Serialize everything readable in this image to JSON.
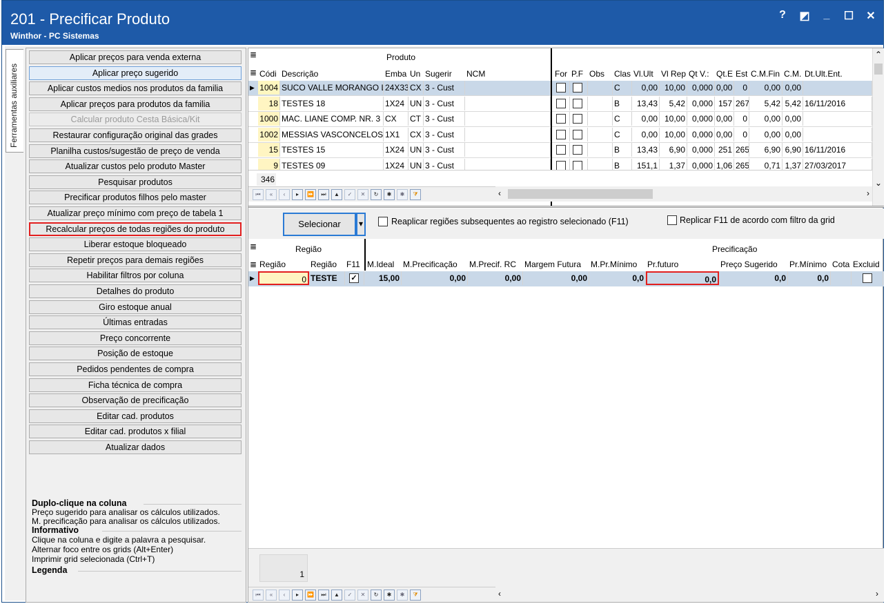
{
  "window": {
    "title": "201 - Precificar Produto",
    "subtitle": "Winthor - PC Sistemas",
    "help": "?",
    "restore": "◩",
    "minimize": "_",
    "maximize": "☐",
    "close": "✕"
  },
  "side_tab": "Ferramentas auxiliares",
  "actions": [
    {
      "label": "Aplicar preços para venda externa",
      "state": "normal"
    },
    {
      "label": "Aplicar preço sugerido",
      "state": "selected"
    },
    {
      "label": "Aplicar custos medios nos produtos da familia",
      "state": "normal"
    },
    {
      "label": "Aplicar preços para produtos da familia",
      "state": "normal"
    },
    {
      "label": "Calcular produto Cesta Básica/Kit",
      "state": "disabled"
    },
    {
      "label": "Restaurar configuração original das grades",
      "state": "normal"
    },
    {
      "label": "Planilha custos/sugestão de preço de venda",
      "state": "normal"
    },
    {
      "label": "Atualizar custos pelo produto Master",
      "state": "normal"
    },
    {
      "label": "Pesquisar produtos",
      "state": "normal"
    },
    {
      "label": "Precificar produtos filhos pelo master",
      "state": "normal"
    },
    {
      "label": "Atualizar preço mínimo com preço de tabela 1",
      "state": "normal"
    },
    {
      "label": "Recalcular preços de todas regiões do produto",
      "state": "highlighted"
    },
    {
      "label": "Liberar estoque bloqueado",
      "state": "normal"
    },
    {
      "label": "Repetir preços para demais regiões",
      "state": "normal"
    },
    {
      "label": "Habilitar filtros por coluna",
      "state": "normal"
    },
    {
      "label": "Detalhes do produto",
      "state": "normal"
    },
    {
      "label": "Giro estoque anual",
      "state": "normal"
    },
    {
      "label": "Últimas entradas",
      "state": "normal"
    },
    {
      "label": "Preço concorrente",
      "state": "normal"
    },
    {
      "label": "Posição de estoque",
      "state": "normal"
    },
    {
      "label": "Pedidos pendentes de compra",
      "state": "normal"
    },
    {
      "label": "Ficha técnica de compra",
      "state": "normal"
    },
    {
      "label": "Observação de precificação",
      "state": "normal"
    },
    {
      "label": "Editar cad. produtos",
      "state": "normal"
    },
    {
      "label": "Editar cad. produtos x filial",
      "state": "normal"
    },
    {
      "label": "Atualizar dados",
      "state": "normal"
    }
  ],
  "info": {
    "dbl_title": "Duplo-clique na coluna",
    "dbl_1": "Preço sugerido para analisar os cálculos utilizados.",
    "dbl_2": "M. precificação para analisar os cálculos utilizados.",
    "inf_title": "Informativo",
    "inf_1": "Clique na coluna e digite a palavra a pesquisar.",
    "inf_2": "Alternar foco entre os grids (Alt+Enter)",
    "inf_3": "Imprimir grid selecionada (Ctrl+T)",
    "leg_title": "Legenda"
  },
  "product_grid": {
    "group_header": "Produto",
    "headers": [
      "Códi",
      "Descrição",
      "Emba",
      "Un",
      "Sugerir",
      "NCM",
      "For",
      "P.F",
      "Obs",
      "Clas",
      "Vl.Ult",
      "Vl Rep",
      "Qt V.:",
      "Qt.E",
      "Est",
      "C.M.Fin",
      "C.M.",
      "Dt.Ult.Ent."
    ],
    "rows": [
      {
        "cod": "1004",
        "desc": "SUCO VALLE MORANGO LA",
        "emb": "24X33",
        "un": "CX",
        "sug": "3 - Cust",
        "clas": "C",
        "vlult": "0,00",
        "vlrep": "10,00",
        "qtv": "0,000",
        "qte": "0,00",
        "est": "0",
        "cmfin": "0,00",
        "cm": "0,00",
        "dt": ""
      },
      {
        "cod": "18",
        "desc": "TESTES 18",
        "emb": "1X24",
        "un": "UN",
        "sug": "3 - Cust",
        "clas": "B",
        "vlult": "13,43",
        "vlrep": "5,42",
        "qtv": "0,000",
        "qte": "157",
        "est": "267",
        "cmfin": "5,42",
        "cm": "5,42",
        "dt": "16/11/2016"
      },
      {
        "cod": "1000",
        "desc": "MAC. LIANE COMP. NR. 3",
        "emb": "CX",
        "un": "CT",
        "sug": "3 - Cust",
        "clas": "C",
        "vlult": "0,00",
        "vlrep": "10,00",
        "qtv": "0,000",
        "qte": "0,00",
        "est": "0",
        "cmfin": "0,00",
        "cm": "0,00",
        "dt": ""
      },
      {
        "cod": "1002",
        "desc": "MESSIAS VASCONCELOS",
        "emb": "1X1",
        "un": "CX",
        "sug": "3 - Cust",
        "clas": "C",
        "vlult": "0,00",
        "vlrep": "10,00",
        "qtv": "0,000",
        "qte": "0,00",
        "est": "0",
        "cmfin": "0,00",
        "cm": "0,00",
        "dt": ""
      },
      {
        "cod": "15",
        "desc": "TESTES 15",
        "emb": "1X24",
        "un": "UN",
        "sug": "3 - Cust",
        "clas": "B",
        "vlult": "13,43",
        "vlrep": "6,90",
        "qtv": "0,000",
        "qte": "251",
        "est": "265",
        "cmfin": "6,90",
        "cm": "6,90",
        "dt": "16/11/2016"
      },
      {
        "cod": "9",
        "desc": "TESTES 09",
        "emb": "1X24",
        "un": "UN",
        "sug": "3 - Cust",
        "clas": "B",
        "vlult": "151,1",
        "vlrep": "1,37",
        "qtv": "0,000",
        "qte": "1,06",
        "est": "265",
        "cmfin": "0,71",
        "cm": "1,37",
        "dt": "27/03/2017"
      }
    ],
    "count": "346"
  },
  "toolbar": {
    "select_label": "Selecionar",
    "select_arrow": "▾",
    "reapply_label": "Reaplicar regiões subsequentes ao registro selecionado (F11)",
    "replicate_label": "Replicar F11 de acordo com filtro da grid"
  },
  "region_grid": {
    "group_region": "Região",
    "group_pricing": "Precificação",
    "headers": [
      "Região",
      "Região",
      "F11",
      "M.Ideal",
      "M.Precificação",
      "M.Precif. RC",
      "Margem Futura",
      "M.Pr.Mínimo",
      "Pr.futuro",
      "Preço Sugerido",
      "Pr.Mínimo",
      "Cota",
      "Excluid"
    ],
    "row": {
      "regiao": "0",
      "nome": "TESTE",
      "mideal": "15,00",
      "mprec": "0,00",
      "mrc": "0,00",
      "mfut": "0,00",
      "mpmin": "0,0",
      "prfut": "0,0",
      "psug": "0,0",
      "pmin": "0,0"
    },
    "count": "1"
  },
  "nav_icons": {
    "first": "⏮",
    "prev_page": "«",
    "prev": "‹",
    "next": "▸",
    "next_page": "⏩",
    "last": "⏭",
    "up": "▲",
    "check": "✓",
    "cancel": "✕",
    "refresh": "↻",
    "insert": "✱",
    "delete": "✱",
    "filter": "⧩",
    "scroll_left": "‹",
    "scroll_right": "›",
    "scroll_up": "⌃",
    "scroll_down": "⌄",
    "row_marker": "▶",
    "grid_menu": "≣"
  }
}
